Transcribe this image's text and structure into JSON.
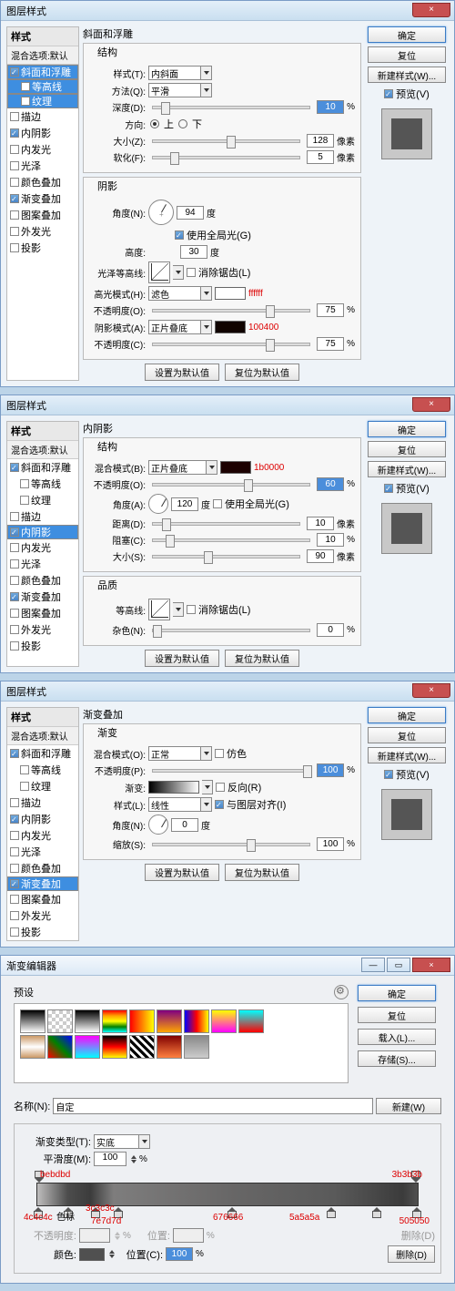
{
  "common": {
    "title": "图层样式",
    "ok": "确定",
    "cancel": "复位",
    "newstyle": "新建样式(W)...",
    "preview": "预览(V)",
    "defaults": "设置为默认值",
    "reset": "复位为默认值",
    "close": "×"
  },
  "side": {
    "header": "样式",
    "blend": "混合选项:默认",
    "items": {
      "bevel": "斜面和浮雕",
      "contour": "等高线",
      "texture": "纹理",
      "stroke": "描边",
      "innerShadow": "内阴影",
      "innerGlow": "内发光",
      "satin": "光泽",
      "colorOverlay": "颜色叠加",
      "gradientOverlay": "渐变叠加",
      "patternOverlay": "图案叠加",
      "outerGlow": "外发光",
      "dropShadow": "投影"
    }
  },
  "d1": {
    "panelTitle": "斜面和浮雕",
    "sect1": "结构",
    "style_l": "样式(T):",
    "style_v": "内斜面",
    "tech_l": "方法(Q):",
    "tech_v": "平滑",
    "depth_l": "深度(D):",
    "depth_v": "10",
    "pct": "%",
    "dir_l": "方向:",
    "up": "上",
    "down": "下",
    "size_l": "大小(Z):",
    "size_v": "128",
    "px": "像素",
    "soften_l": "软化(F):",
    "soften_v": "5",
    "sect2": "阴影",
    "angle_l": "角度(N):",
    "angle_v": "94",
    "deg": "度",
    "global": "使用全局光(G)",
    "alt_l": "高度:",
    "alt_v": "30",
    "gloss_l": "光泽等高线:",
    "anti": "消除锯齿(L)",
    "hi_l": "高光模式(H):",
    "hi_v": "滤色",
    "hi_color": "ffffff",
    "hi_op_l": "不透明度(O):",
    "hi_op_v": "75",
    "sh_l": "阴影模式(A):",
    "sh_v": "正片叠底",
    "sh_color": "100400",
    "sh_op_l": "不透明度(C):",
    "sh_op_v": "75"
  },
  "d2": {
    "panelTitle": "内阴影",
    "sect1": "结构",
    "blend_l": "混合模式(B):",
    "blend_v": "正片叠底",
    "color": "1b0000",
    "op_l": "不透明度(O):",
    "op_v": "60",
    "pct": "%",
    "angle_l": "角度(A):",
    "angle_v": "120",
    "deg": "度",
    "global": "使用全局光(G)",
    "dist_l": "距离(D):",
    "dist_v": "10",
    "px": "像素",
    "choke_l": "阻塞(C):",
    "choke_v": "10",
    "size_l": "大小(S):",
    "size_v": "90",
    "sect2": "品质",
    "contour_l": "等高线:",
    "anti": "消除锯齿(L)",
    "noise_l": "杂色(N):",
    "noise_v": "0"
  },
  "d3": {
    "panelTitle": "渐变叠加",
    "sect1": "渐变",
    "blend_l": "混合模式(O):",
    "blend_v": "正常",
    "dither": "仿色",
    "op_l": "不透明度(P):",
    "op_v": "100",
    "pct": "%",
    "grad_l": "渐变:",
    "reverse": "反向(R)",
    "style_l": "样式(L):",
    "style_v": "线性",
    "align": "与图层对齐(I)",
    "angle_l": "角度(N):",
    "angle_v": "0",
    "deg": "度",
    "scale_l": "缩放(S):",
    "scale_v": "100"
  },
  "ge": {
    "title": "渐变编辑器",
    "presets": "预设",
    "ok": "确定",
    "cancel": "复位",
    "load": "载入(L)...",
    "save": "存储(S)...",
    "name_l": "名称(N):",
    "name_v": "自定",
    "new": "新建(W)",
    "type_l": "渐变类型(T):",
    "type_v": "实底",
    "smooth_l": "平滑度(M):",
    "smooth_v": "100",
    "pct": "%",
    "opacity_l": "不透明度:",
    "loc_l": "位置:",
    "delete1": "删除(D)",
    "color_l": "颜色:",
    "loc2_l": "位置(C):",
    "loc2_v": "100",
    "delete2": "删除(D)",
    "stops": {
      "s1": "bebdbd",
      "s2": "4c4c4c",
      "s3": "3c3c3c",
      "s4": "7e7d7d",
      "s5": "676666",
      "s6": "5a5a5a",
      "s7": "3b3b3b",
      "s8": "505050"
    },
    "colorsLabel": "色标"
  }
}
